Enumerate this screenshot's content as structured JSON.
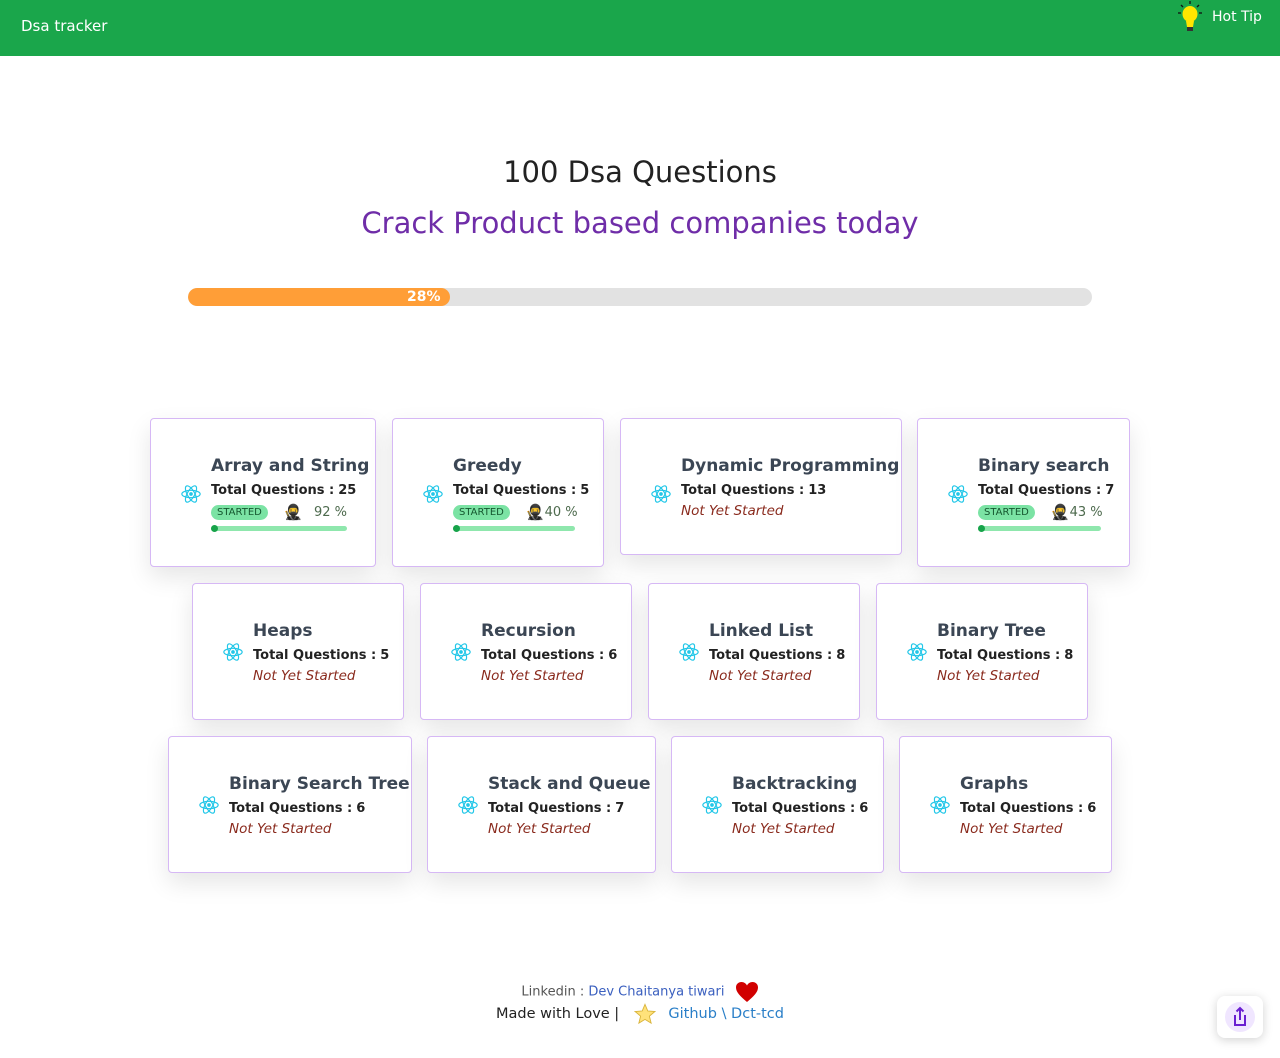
{
  "nav": {
    "brand": "Dsa tracker",
    "hot_tip": "Hot Tip"
  },
  "hero": {
    "title": "100 Dsa Questions",
    "subtitle": "Crack Product based companies today"
  },
  "overall_progress": {
    "percent": 28,
    "label": "28%"
  },
  "card_labels": {
    "total_prefix": "Total Questions :",
    "started_badge": "STARTED",
    "not_started": "Not Yet Started"
  },
  "topics": [
    {
      "name": "Array and String",
      "total": "25",
      "started": true,
      "percent_label": "92 %",
      "percent": 92
    },
    {
      "name": "Greedy",
      "total": "5",
      "started": true,
      "percent_label": "40 %",
      "percent": 40
    },
    {
      "name": "Dynamic Programming",
      "total": "13",
      "started": false
    },
    {
      "name": "Binary search",
      "total": "7",
      "started": true,
      "percent_label": "43 %",
      "percent": 43
    },
    {
      "name": "Heaps",
      "total": "5",
      "started": false
    },
    {
      "name": "Recursion",
      "total": "6",
      "started": false
    },
    {
      "name": "Linked List",
      "total": "8",
      "started": false
    },
    {
      "name": "Binary Tree",
      "total": "8",
      "started": false
    },
    {
      "name": "Binary Search Tree",
      "total": "6",
      "started": false
    },
    {
      "name": "Stack and Queue",
      "total": "7",
      "started": false
    },
    {
      "name": "Backtracking",
      "total": "6",
      "started": false
    },
    {
      "name": "Graphs",
      "total": "6",
      "started": false
    }
  ],
  "footer": {
    "linkedin_label": "Linkedin :",
    "linkedin_name": "Dev Chaitanya tiwari",
    "made_with": "Made with Love |",
    "github_link": "Github \\ Dct-tcd"
  },
  "colors": {
    "navbar": "#1aa64b",
    "accent_purple": "#6f2da8",
    "progress_fill": "#ff9e37",
    "card_border": "#d6b8f5",
    "started_badge": "#7be3a4",
    "not_started_text": "#8a2b1e"
  },
  "icons": {
    "topic": "react-atom-icon",
    "tip": "lightbulb-icon",
    "heart": "heart-icon",
    "star": "star-icon",
    "progress_user": "ninja-emoji",
    "share": "share-icon"
  }
}
